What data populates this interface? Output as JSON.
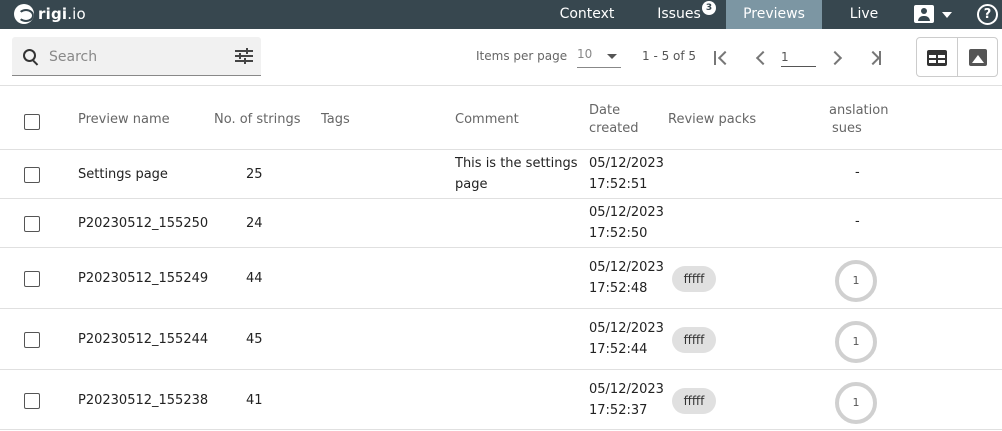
{
  "app": {
    "logo_name": "rigi",
    "logo_suffix": ".io"
  },
  "nav": {
    "context": "Context",
    "issues": "Issues",
    "issues_badge": "3",
    "previews": "Previews",
    "live": "Live",
    "help": "?"
  },
  "toolbar": {
    "search_placeholder": "Search",
    "items_per_page_label": "Items per page",
    "items_per_page_value": "10",
    "range": "1 - 5 of 5",
    "page_value": "1"
  },
  "table": {
    "headers": {
      "name": "Preview name",
      "strings": "No. of strings",
      "tags": "Tags",
      "comment": "Comment",
      "date_line1": "Date",
      "date_line2": "created",
      "review_packs": "Review packs",
      "issues_line1": "anslation",
      "issues_line2": "sues"
    },
    "rows": [
      {
        "name": "Settings page",
        "strings": "25",
        "comment_line1": "This is the settings",
        "comment_line2": "page",
        "date": "05/12/2023",
        "time": "17:52:51",
        "pack": "",
        "issues": "-"
      },
      {
        "name": "P20230512_155250",
        "strings": "24",
        "comment_line1": "",
        "comment_line2": "",
        "date": "05/12/2023",
        "time": "17:52:50",
        "pack": "",
        "issues": "-"
      },
      {
        "name": "P20230512_155249",
        "strings": "44",
        "comment_line1": "",
        "comment_line2": "",
        "date": "05/12/2023",
        "time": "17:52:48",
        "pack": "fffff",
        "issues": "1"
      },
      {
        "name": "P20230512_155244",
        "strings": "45",
        "comment_line1": "",
        "comment_line2": "",
        "date": "05/12/2023",
        "time": "17:52:44",
        "pack": "fffff",
        "issues": "1"
      },
      {
        "name": "P20230512_155238",
        "strings": "41",
        "comment_line1": "",
        "comment_line2": "",
        "date": "05/12/2023",
        "time": "17:52:37",
        "pack": "fffff",
        "issues": "1"
      }
    ]
  }
}
